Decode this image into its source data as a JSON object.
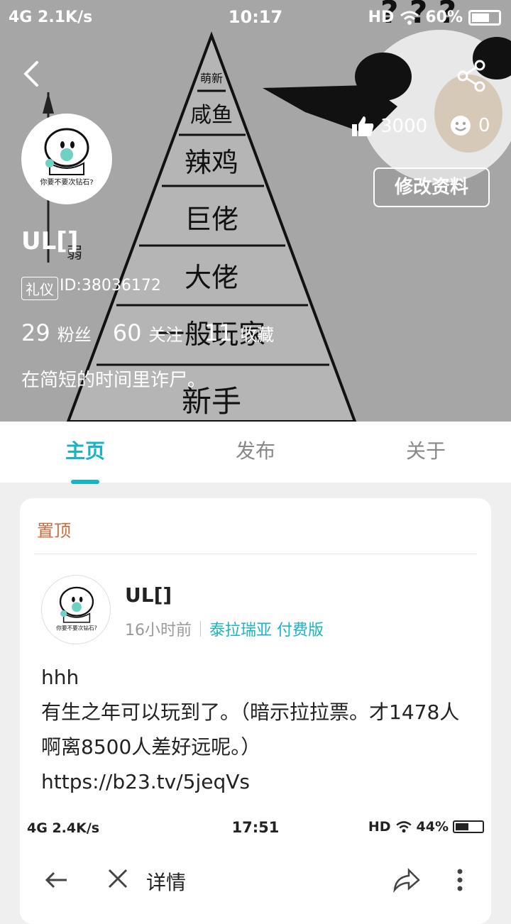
{
  "status_bar": {
    "network": "4G",
    "speed": "2.1K/s",
    "time": "10:17",
    "hd": "HD",
    "battery": "60%"
  },
  "meme": {
    "pyramid_levels": [
      "萌新",
      "咸鱼",
      "辣鸡",
      "巨佬",
      "大佬",
      "一般玩家",
      "新手"
    ],
    "arrow_label": "弱"
  },
  "header": {
    "likes": "3000",
    "smiles": "0",
    "edit_label": "修改资料"
  },
  "profile": {
    "username": "UL[]",
    "badge": "礼仪",
    "uid": "ID:38036172",
    "fans_count": "29",
    "fans_label": "粉丝",
    "following_count": "60",
    "following_label": "关注",
    "favorites_count": "11",
    "favorites_label": "收藏",
    "bio": "在简短的时间里诈尸。",
    "avatar_caption": "你要不要次钻石?"
  },
  "tabs": [
    {
      "label": "主页",
      "active": true
    },
    {
      "label": "发布",
      "active": false
    },
    {
      "label": "关于",
      "active": false
    }
  ],
  "post": {
    "pinned_label": "置顶",
    "author": "UL[]",
    "time": "16小时前",
    "game": "泰拉瑞亚 付费版",
    "text_line1": "hhh",
    "text_body": "有生之年可以玩到了。（暗示拉拉票。才1478人啊离8500人差好远呢。）https://b23.tv/5jeqVs",
    "avatar_caption": "你要不要次钻石?"
  },
  "embedded_screenshot": {
    "network": "4G",
    "speed": "2.4K/s",
    "time": "17:51",
    "hd": "HD",
    "battery": "44%",
    "title": "详情"
  },
  "colors": {
    "accent": "#1ab3c3",
    "pinned": "#d06a3c"
  }
}
